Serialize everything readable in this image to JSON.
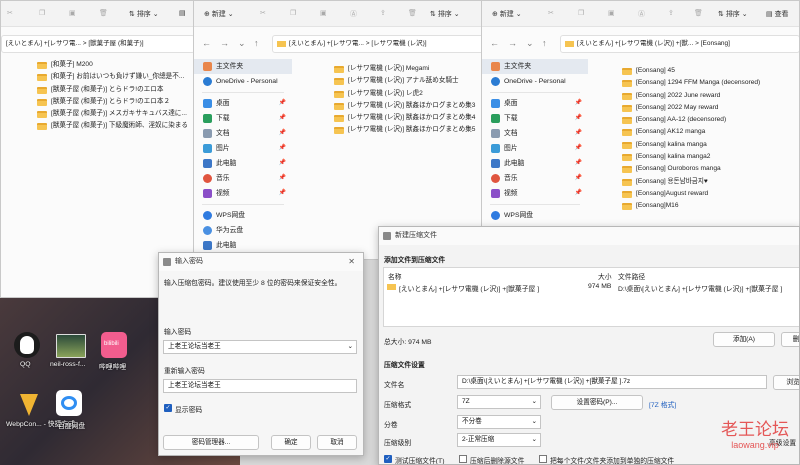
{
  "colors": {
    "folder": "#f6c451",
    "accent": "#1f5fbf",
    "desktop": "#3a3138"
  },
  "win1": {
    "toolbar": {
      "sort": "排序"
    },
    "address": "[えいとまん] +[レサワ電... > [獣菓子屋 (和菓子)]",
    "files": [
      "[和菓子] M200",
      "[和菓子] お前はいつも負けず嫌い_你總是不...",
      "[獣菓子屋 (和菓子)] とらドラ!のエロ本",
      "[獣菓子屋 (和菓子)] とらドラ!のエロ本２",
      "[獣菓子屋 (和菓子)] メスガキサキュバス達に...",
      "[獣菓子屋 (和菓子)] 下級魔術師、淫奴に染まる"
    ]
  },
  "win2": {
    "toolbar": {
      "new": "新建",
      "sort": "排序",
      "view": "查看"
    },
    "address": "[えいとまん] +[レサワ電... > [レサワ電機 (レ沢)]",
    "sidebar": [
      "主文件夹",
      "OneDrive - Personal",
      "桌面",
      "下载",
      "文档",
      "图片",
      "此电脑",
      "音乐",
      "视频",
      "WPS网盘",
      "华为云盘",
      "此电脑",
      "网络"
    ],
    "files": [
      "[レサワ電機 (レ沢)] Megami",
      "[レサワ電機 (レ沢)] アナル舐め女騎士",
      "[レサワ電機 (レ沢)] レ虎2",
      "[レサワ電機 (レ沢)] 獣姦ほかログまとめ集3",
      "[レサワ電機 (レ沢)] 獣姦ほかログまとめ集4",
      "[レサワ電機 (レ沢)] 獣姦ほかログまとめ集5"
    ]
  },
  "win3": {
    "toolbar": {
      "new": "新建",
      "sort": "排序",
      "view": "查看"
    },
    "address": "[えいとまん] +[レサワ電機 (レ沢)] +[獣... > [Eonsang]",
    "sidebar": [
      "主文件夹",
      "OneDrive - Personal",
      "桌面",
      "下载",
      "文档",
      "图片",
      "此电脑",
      "音乐",
      "视频",
      "WPS网盘"
    ],
    "files": [
      "[Eonsang] 45",
      "[Eonsang] 1294 FFM Manga (decensored)",
      "[Eonsang] 2022 June reward",
      "[Eonsang] 2022 May reward",
      "[Eonsang] AA-12 (decensored)",
      "[Eonsang] AK12 manga",
      "[Eonsang] kalina manga",
      "[Eonsang] kalina manga2",
      "[Eonsang] Ouroboros manga",
      "[Eonsang] 용돈남바금지♥",
      "[Eonsang]August reward",
      "[Eonsang]M16"
    ]
  },
  "desktop": {
    "icons": [
      "QQ",
      "neil-ross-f...",
      "哔哩哔哩",
      "WebpCon... - 快捷方式",
      "百度网盘"
    ]
  },
  "password_dialog": {
    "title": "输入密码",
    "hint": "输入压缩包密码。建议使用至少 8 位的密码来保证安全性。",
    "password_label": "输入密码",
    "password_value": "上老王论坛当老王",
    "repeat_label": "重新输入密码",
    "repeat_value": "上老王论坛当老王",
    "show_password": "显示密码",
    "manager_button": "密码管理器...",
    "ok_button": "确定",
    "cancel_button": "取消"
  },
  "archive_dialog": {
    "title": "新建压缩文件",
    "section_add": "添加文件到压缩文件",
    "col_name": "名称",
    "col_size": "大小",
    "col_path": "文件路径",
    "row": {
      "name": "[えいとまん] +[レサワ電機 (レ沢)] +[獣菓子屋 ]",
      "size": "974 MB",
      "path": "D:\\桌面\\[えいとまん] +[レサワ電機 (レ沢)] +[獣菓子屋 ]"
    },
    "total": "总大小: 974 MB",
    "add_button": "添加(A)",
    "remove_button": "删",
    "section_settings": "压缩文件设置",
    "filename_label": "文件名",
    "filename_value": "D:\\桌面\\[えいとまん] +[レサワ電機 (レ沢)] +[獣菓子屋 ].7z",
    "browse_button": "浏览",
    "format_label": "压缩格式",
    "format_value": "7Z",
    "set_password_button": "设置密码(P)...",
    "format_note": "[7Z 格式]",
    "split_label": "分卷",
    "split_value": "不分卷",
    "level_label": "压缩级别",
    "level_value": "2-正常压缩",
    "advanced": "高级设置",
    "check_test": "测试压缩文件(T)",
    "check_delete": "压缩后删除源文件",
    "check_separate": "把每个文件/文件夹添加到单独的压缩文件"
  },
  "watermark": {
    "text": "老王论坛",
    "url": "laowang.vip"
  }
}
